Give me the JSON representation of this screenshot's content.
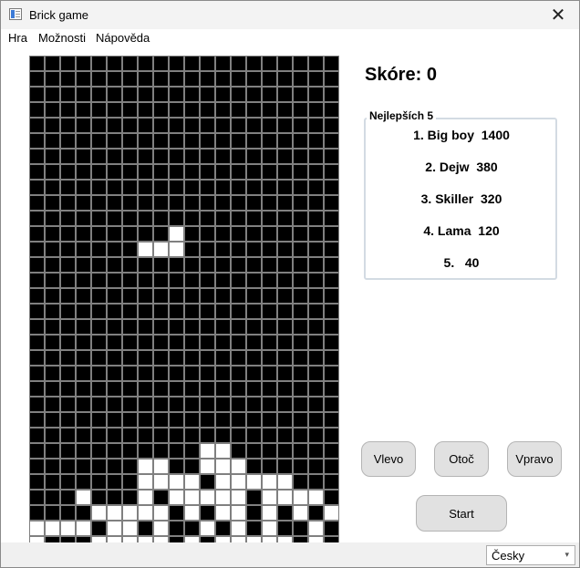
{
  "window": {
    "title": "Brick game",
    "close_glyph": "✕"
  },
  "menu": [
    "Hra",
    "Možnosti",
    "Nápověda"
  ],
  "score": {
    "label": "Skóre:",
    "value": "0"
  },
  "highscores": {
    "title": "Nejlepších 5",
    "entries": [
      "1. Big boy  1400",
      "2. Dejw  380",
      "3. Skiller  320",
      "4. Lama  120",
      "5.   40"
    ]
  },
  "controls": {
    "left": "Vlevo",
    "rotate": "Otoč",
    "right": "Vpravo",
    "start": "Start"
  },
  "language": {
    "selected": "Česky",
    "icon": "chevron-down-icon"
  },
  "board": {
    "cols": 20,
    "rows": 30,
    "colors": {
      "empty": "#000000",
      "filled": "#ffffff",
      "grid": "#808080"
    },
    "cells": [
      "....................",
      "....................",
      "....................",
      "....................",
      "....................",
      "....................",
      "....................",
      "....................",
      "....................",
      "....................",
      "....................",
      ".........#..........",
      ".......###..........",
      "....................",
      "....................",
      "....................",
      "....................",
      "....................",
      "....................",
      "....................",
      "....................",
      "....................",
      "....................",
      "....................",
      "....................",
      "...........##.......",
      ".......##..###......",
      ".......####.#####...",
      "...#...#.#####.####.",
      "....#####.#.##.#.#.#",
      "####.##.#..#.#.#..#.",
      "#...#####.#.#####.#."
    ]
  }
}
